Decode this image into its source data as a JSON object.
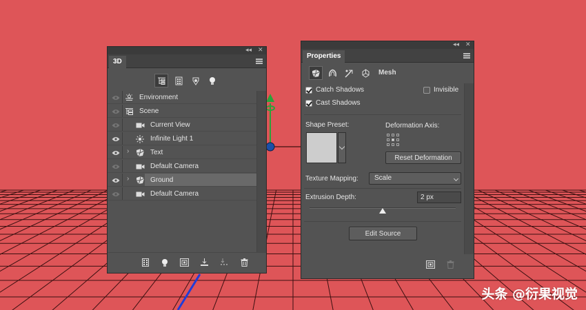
{
  "colors": {
    "background": "#de5558",
    "grid_line": "#3a1010",
    "panel_bg": "#535353",
    "selected_row": "#696969",
    "axis_green": "#2aa33a",
    "axis_blue": "#1f3cd8"
  },
  "panel_3d": {
    "tab_label": "3D",
    "filter_icons": [
      "scene-filter-icon",
      "mesh-filter-icon",
      "material-filter-icon",
      "light-filter-icon"
    ],
    "layers": [
      {
        "name": "Environment",
        "icon": "environment-icon",
        "indent": 0,
        "expandable": false,
        "eye": "dim",
        "selected": false
      },
      {
        "name": "Scene",
        "icon": "scene-icon",
        "indent": 0,
        "expandable": false,
        "eye": "dim",
        "selected": false
      },
      {
        "name": "Current View",
        "icon": "camera-icon",
        "indent": 1,
        "expandable": false,
        "eye": "dim",
        "selected": false
      },
      {
        "name": "Infinite Light 1",
        "icon": "light-icon",
        "indent": 1,
        "expandable": false,
        "eye": "on",
        "selected": false
      },
      {
        "name": "Text",
        "icon": "mesh-icon",
        "indent": 1,
        "expandable": true,
        "eye": "on",
        "selected": false
      },
      {
        "name": "Default Camera",
        "icon": "camera-icon",
        "indent": 1,
        "expandable": false,
        "eye": "dim",
        "selected": false
      },
      {
        "name": "Ground",
        "icon": "mesh-icon",
        "indent": 1,
        "expandable": true,
        "eye": "on",
        "selected": true
      },
      {
        "name": "Default Camera",
        "icon": "camera-icon",
        "indent": 1,
        "expandable": false,
        "eye": "dim",
        "selected": false
      }
    ],
    "bottom_buttons": [
      "new-mesh-icon",
      "new-light-icon",
      "add-constraint-icon",
      "drop-to-ground-icon",
      "render-icon",
      "trash-icon"
    ]
  },
  "properties": {
    "tab_label": "Properties",
    "icon_tabs": [
      "mesh-tab-icon",
      "deform-tab-icon",
      "cap-tab-icon",
      "coordinates-tab-icon"
    ],
    "mode_label": "Mesh",
    "catch_shadows": {
      "label": "Catch Shadows",
      "checked": true
    },
    "invisible": {
      "label": "Invisible",
      "checked": false
    },
    "cast_shadows": {
      "label": "Cast Shadows",
      "checked": true
    },
    "shape_preset_label": "Shape Preset:",
    "deformation_axis_label": "Deformation Axis:",
    "reset_deformation_label": "Reset Deformation",
    "texture_mapping_label": "Texture Mapping:",
    "texture_mapping_value": "Scale",
    "extrusion_depth_label": "Extrusion Depth:",
    "extrusion_depth_value": "2 px",
    "extrusion_slider_fraction": 0.5,
    "edit_source_label": "Edit Source"
  },
  "watermark": "头条 @衍果视觉"
}
